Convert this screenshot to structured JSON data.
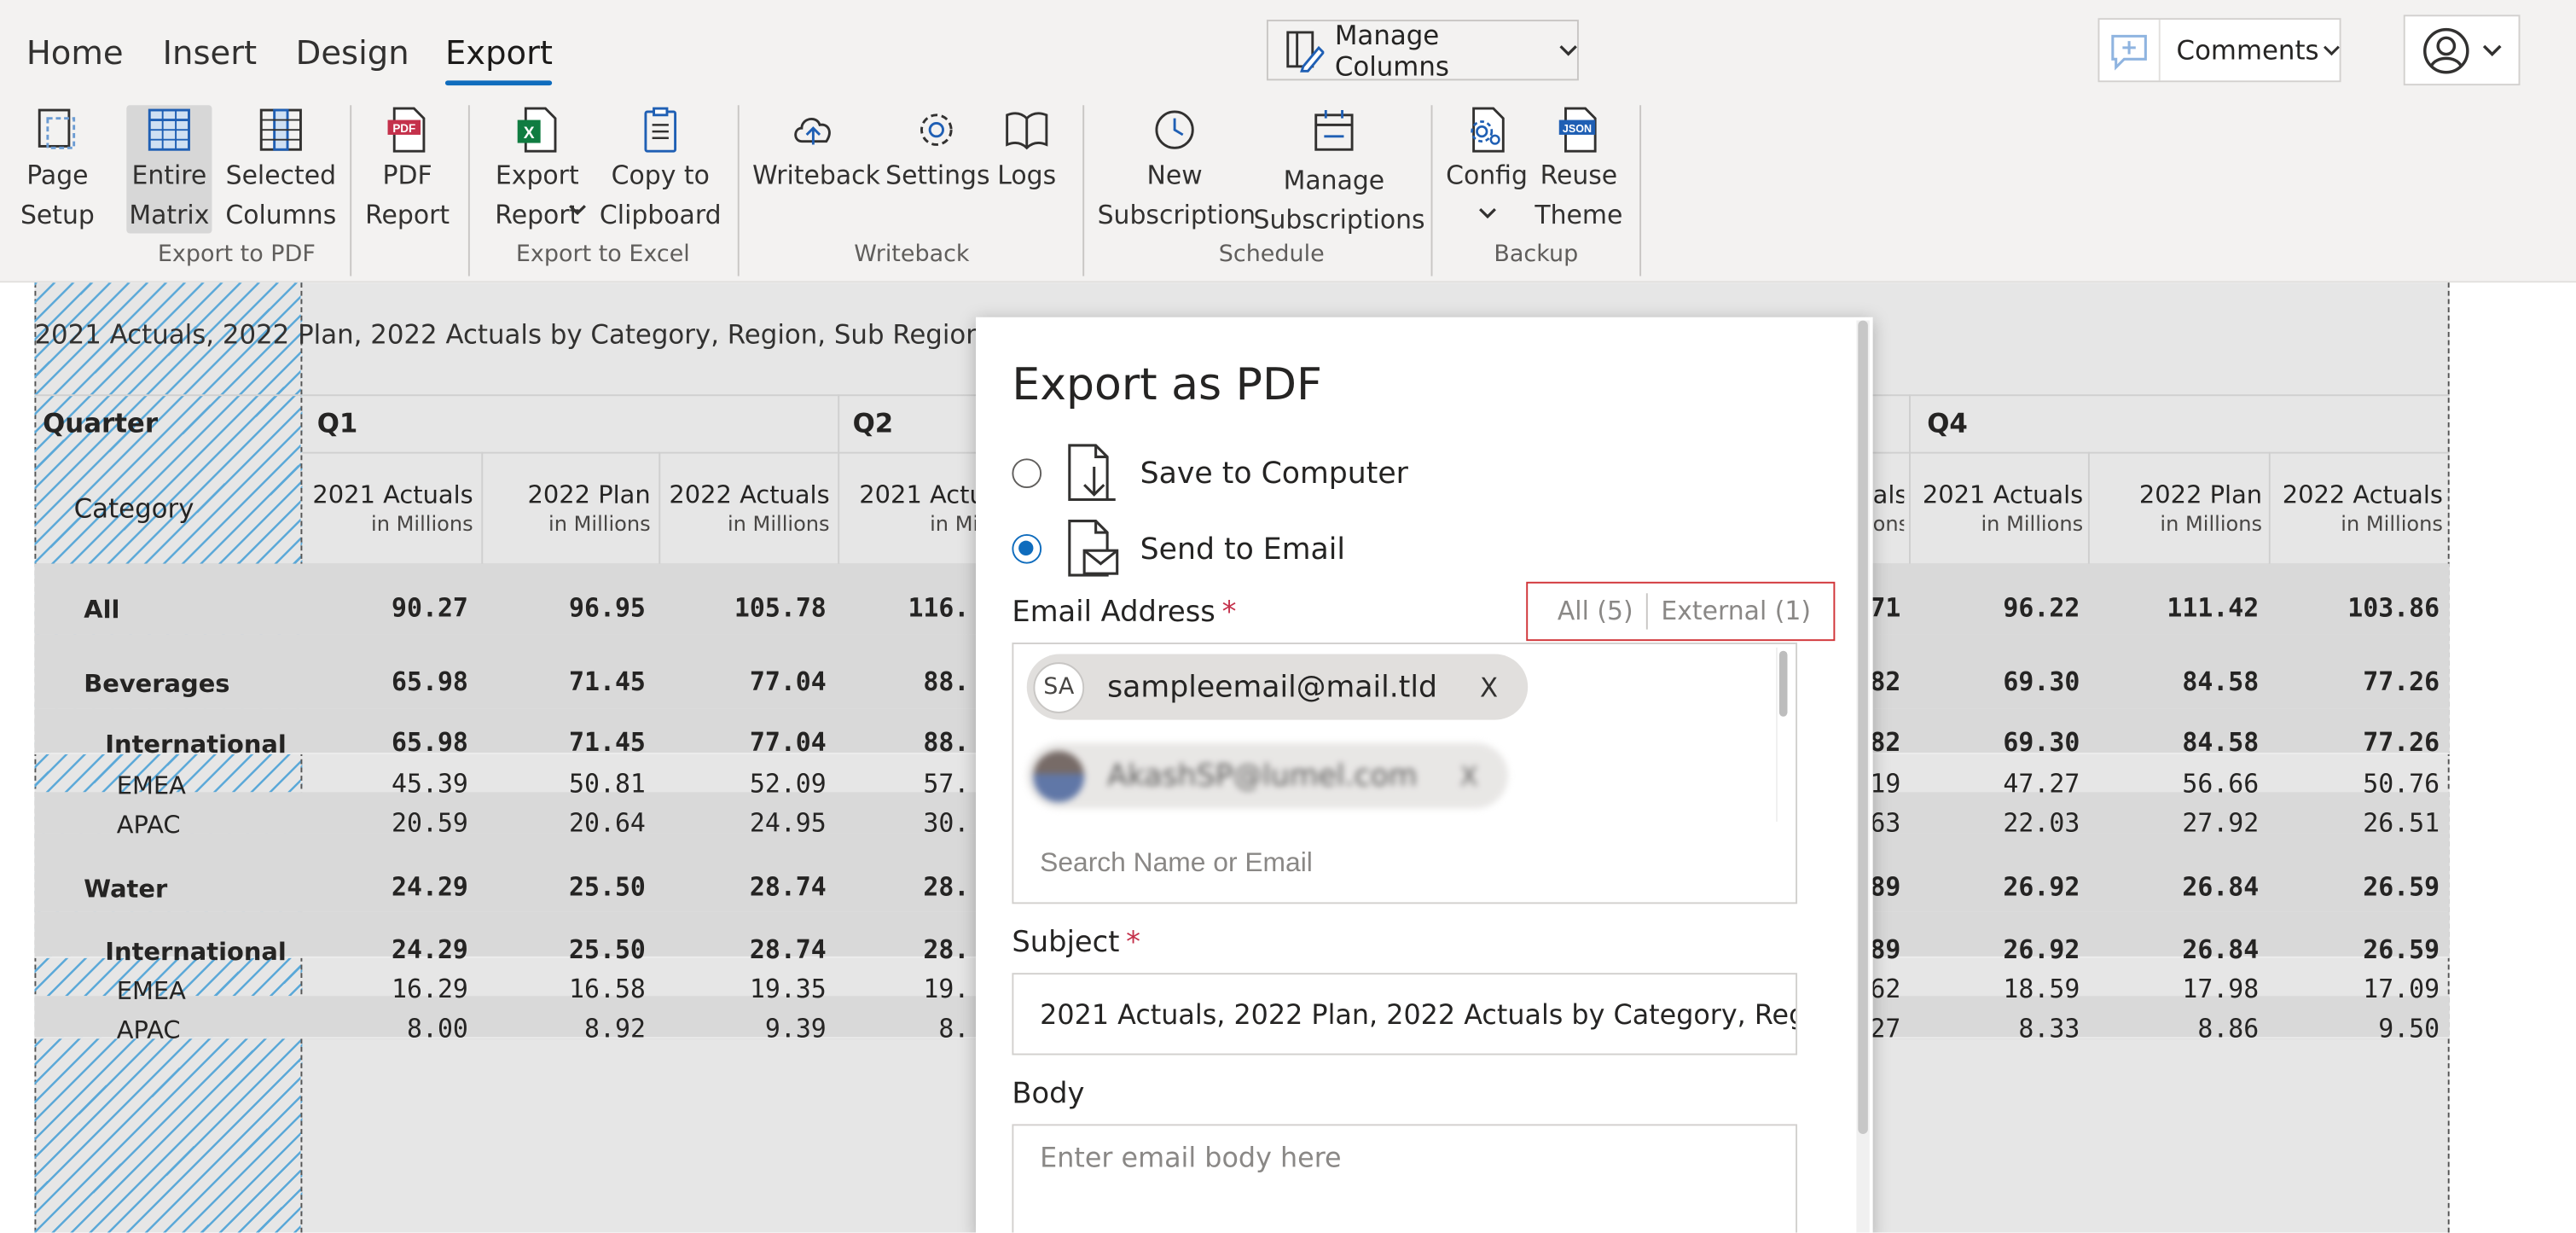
{
  "ribbon": {
    "tabs": [
      "Home",
      "Insert",
      "Design",
      "Export"
    ],
    "active_tab": "Export",
    "manage_columns": "Manage Columns",
    "comments": "Comments",
    "buttons": {
      "page_setup": "Page\nSetup",
      "entire_matrix": "Entire\nMatrix",
      "selected_columns": "Selected\nColumns",
      "pdf_report": "PDF\nReport",
      "export_report": "Export\nReport",
      "copy_clipboard": "Copy to\nClipboard",
      "writeback": "Writeback",
      "settings": "Settings",
      "logs": "Logs",
      "new_subscription": "New\nSubscription",
      "manage_subscriptions": "Manage\nSubscriptions",
      "config": "Config",
      "reuse_theme": "Reuse\nTheme"
    },
    "groups": {
      "export_pdf": "Export to PDF",
      "export_excel": "Export to Excel",
      "writeback": "Writeback",
      "schedule": "Schedule",
      "backup": "Backup"
    }
  },
  "report": {
    "caption": "2021 Actuals, 2022 Plan, 2022 Actuals by Category, Region, Sub Region, Quarter",
    "row_header_quarter": "Quarter",
    "row_header_category": "Category",
    "quarters": [
      "Q1",
      "Q2",
      "Q4"
    ],
    "measure_unit": "in Millions",
    "columns_left": [
      "2021 Actuals",
      "2022 Plan",
      "2022 Actuals",
      "2021 Actu"
    ],
    "columns_right": [
      "als",
      "2021 Actuals",
      "2022 Plan",
      "2022 Actuals"
    ],
    "right_unit_fragment": "ons",
    "rows": [
      {
        "label": "All",
        "left": [
          "90.27",
          "96.95",
          "105.78",
          "116."
        ],
        "right": [
          "71",
          "96.22",
          "111.42",
          "103.86"
        ]
      },
      {
        "label": "Beverages",
        "left": [
          "65.98",
          "71.45",
          "77.04",
          "88."
        ],
        "right": [
          "82",
          "69.30",
          "84.58",
          "77.26"
        ]
      },
      {
        "label": "International",
        "left": [
          "65.98",
          "71.45",
          "77.04",
          "88."
        ],
        "right": [
          "82",
          "69.30",
          "84.58",
          "77.26"
        ]
      },
      {
        "label": "EMEA",
        "left": [
          "45.39",
          "50.81",
          "52.09",
          "57."
        ],
        "right": [
          "19",
          "47.27",
          "56.66",
          "50.76"
        ]
      },
      {
        "label": "APAC",
        "left": [
          "20.59",
          "20.64",
          "24.95",
          "30."
        ],
        "right": [
          "63",
          "22.03",
          "27.92",
          "26.51"
        ]
      },
      {
        "label": "Water",
        "left": [
          "24.29",
          "25.50",
          "28.74",
          "28."
        ],
        "right": [
          "89",
          "26.92",
          "26.84",
          "26.59"
        ]
      },
      {
        "label": "International",
        "left": [
          "24.29",
          "25.50",
          "28.74",
          "28."
        ],
        "right": [
          "89",
          "26.92",
          "26.84",
          "26.59"
        ]
      },
      {
        "label": "EMEA",
        "left": [
          "16.29",
          "16.58",
          "19.35",
          "19."
        ],
        "right": [
          "62",
          "18.59",
          "17.98",
          "17.09"
        ]
      },
      {
        "label": "APAC",
        "left": [
          "8.00",
          "8.92",
          "9.39",
          "8."
        ],
        "right": [
          "27",
          "8.33",
          "8.86",
          "9.50"
        ]
      }
    ]
  },
  "dialog": {
    "title": "Export as PDF",
    "option_save": "Save to Computer",
    "option_email": "Send to Email",
    "selected_option": "email",
    "email_label": "Email Address",
    "required_mark": "*",
    "filter_all": "All (5)",
    "filter_external": "External (1)",
    "recipients": [
      {
        "initials": "SA",
        "email": "sampleemail@mail.tld"
      },
      {
        "initials": "",
        "email": "AkashSP@lumel.com"
      }
    ],
    "remove_label": "X",
    "search_placeholder": "Search Name or Email",
    "subject_label": "Subject",
    "subject_value": "2021 Actuals, 2022 Plan, 2022 Actuals by Category, Reg...",
    "body_label": "Body",
    "body_placeholder": "Enter email body here"
  },
  "colors": {
    "accent": "#0f6cbd",
    "required": "#c4314b",
    "filter_border": "#d13438",
    "hatch": "#5aa8d8"
  }
}
